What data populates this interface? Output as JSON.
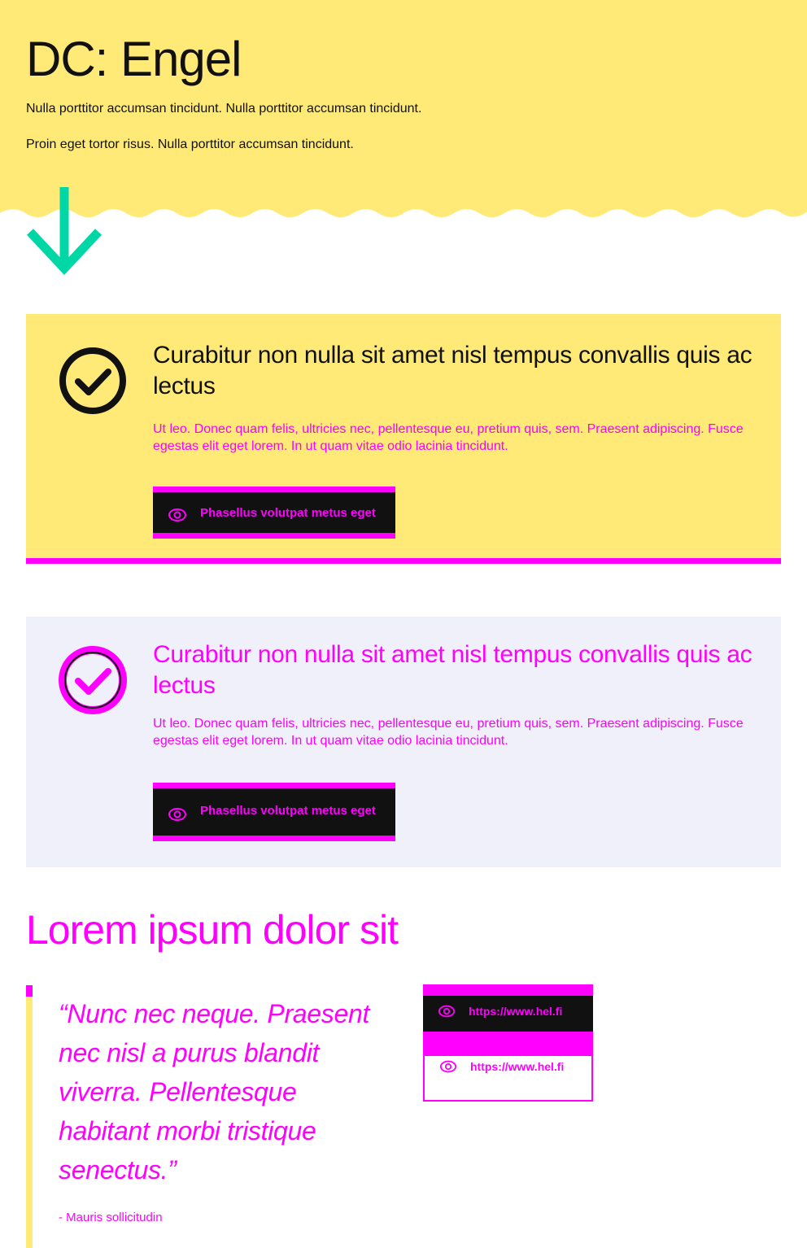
{
  "hero": {
    "title": "DC: Engel",
    "paragraph_1": "Nulla porttitor accumsan tincidunt. Nulla porttitor accumsan tincidunt.",
    "paragraph_2": "Proin eget tortor risus. Nulla porttitor accumsan tincidunt.",
    "background_color": "#ffe977",
    "arrow_icon": "arrow-down-icon",
    "arrow_color": "#00d7a7"
  },
  "notification_1": {
    "icon": "check-circle-icon",
    "title": "Curabitur non nulla sit amet nisl tempus convallis quis ac lectus",
    "text": "Ut leo. Donec quam felis, ultricies nec, pellentesque eu, pretium quis, sem. Praesent adipiscing. Fusce egestas elit eget lorem. In ut quam vitae odio lacinia tincidunt.",
    "button_label": "Phasellus volutpat metus eget",
    "button_icon": "eye-icon",
    "background_color": "#ffe977",
    "accent_color": "#ff00ff"
  },
  "notification_2": {
    "icon": "check-circle-icon",
    "title": "Curabitur non nulla sit amet nisl tempus convallis quis ac lectus",
    "text": "Ut leo. Donec quam felis, ultricies nec, pellentesque eu, pretium quis, sem. Praesent adipiscing. Fusce egestas elit eget lorem. In ut quam vitae odio lacinia tincidunt.",
    "button_label": "Phasellus volutpat metus eget",
    "button_icon": "eye-icon",
    "background_color": "#f0f0fa"
  },
  "section": {
    "title": "Lorem ipsum dolor sit",
    "quote": "“Nunc nec neque. Praesent nec nisl a purus blandit viverra. Pellentesque habitant morbi tristique senectus.”",
    "attribution": "- Mauris sollicitudin",
    "links": [
      {
        "label": "https://www.hel.fi",
        "icon": "eye-icon",
        "style": "dark"
      },
      {
        "label": "https://www.hel.fi",
        "icon": "eye-icon",
        "style": "light"
      }
    ]
  }
}
